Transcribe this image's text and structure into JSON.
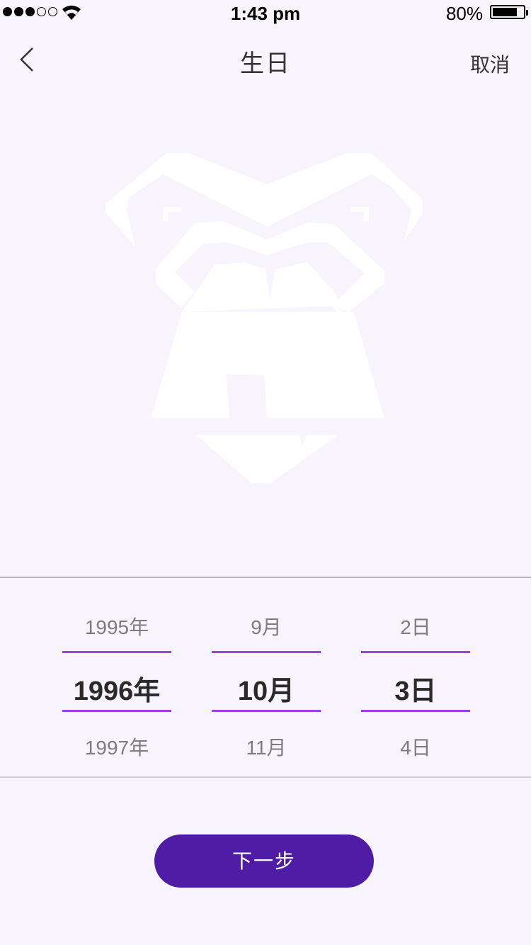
{
  "status_bar": {
    "time": "1:43 pm",
    "battery_percent": "80%",
    "battery_level": 0.8,
    "signal_bars_filled": 3,
    "signal_bars_total": 5
  },
  "nav": {
    "title": "生日",
    "cancel_label": "取消",
    "back_icon": "chevron-left-icon"
  },
  "logo": {
    "icon": "gorilla-logo-icon",
    "color": "#ffffff"
  },
  "picker": {
    "year": {
      "prev": "1995年",
      "selected": "1996年",
      "next": "1997年"
    },
    "month": {
      "prev": "9月",
      "selected": "10月",
      "next": "11月"
    },
    "day": {
      "prev": "2日",
      "selected": "3日",
      "next": "4日"
    },
    "highlight_color": "#9b43d8"
  },
  "next_button_label": "下一步",
  "colors": {
    "background": "#f7f4fd",
    "button": "#4f1ca6",
    "highlight": "#9b43d8"
  }
}
